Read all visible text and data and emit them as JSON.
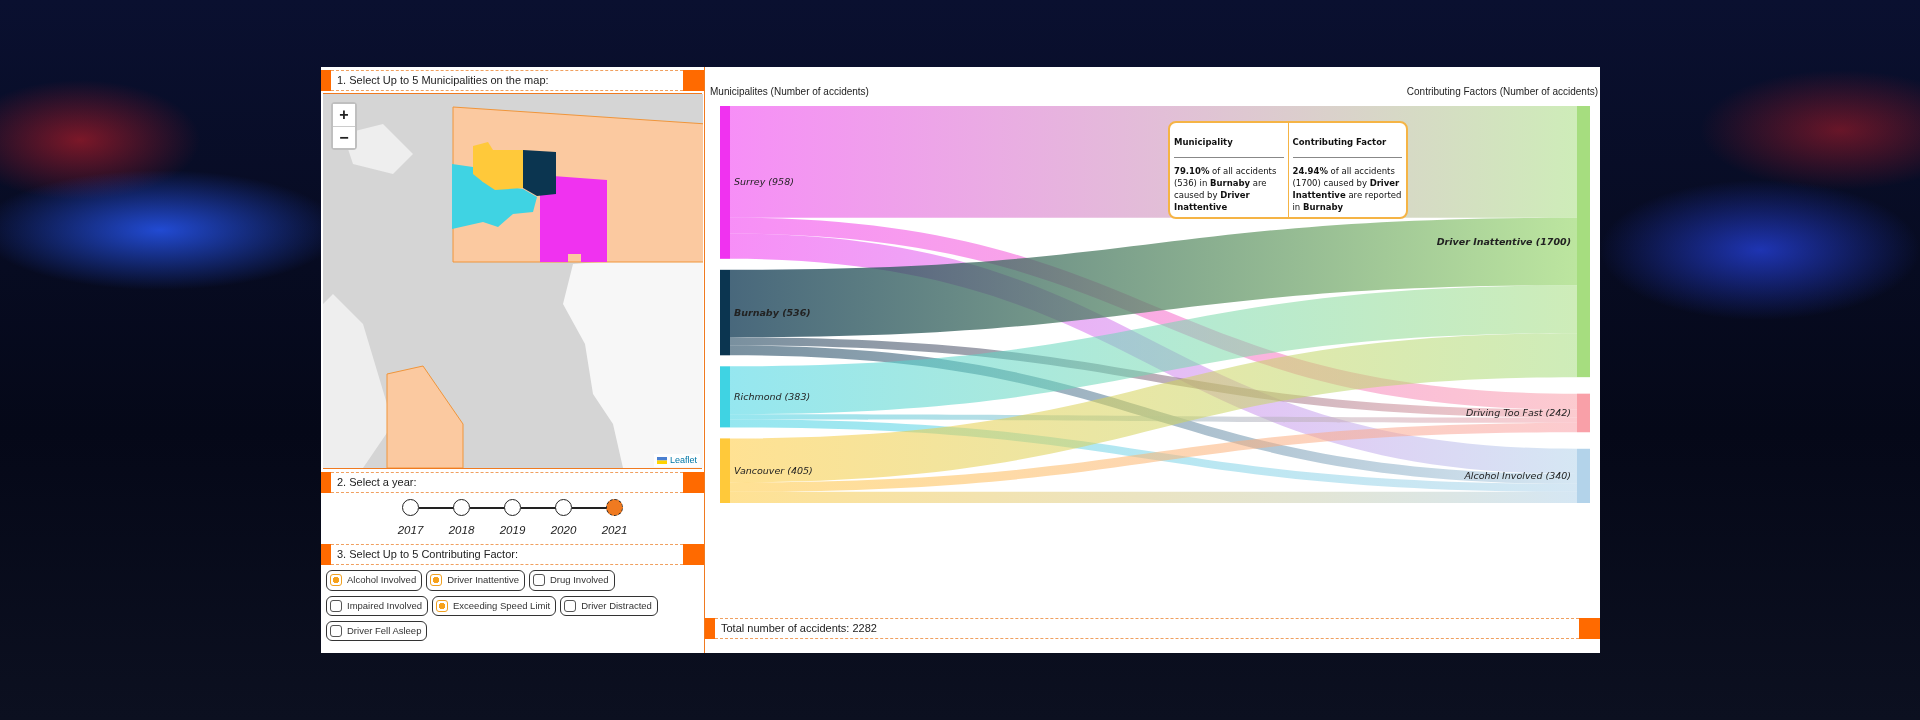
{
  "map_panel": {
    "heading": "1. Select Up to 5 Municipalities on the map:",
    "zoom_in": "+",
    "zoom_out": "−",
    "attribution": "Leaflet"
  },
  "year_panel": {
    "heading": "2. Select a year:",
    "years": [
      {
        "label": "2017",
        "selected": false
      },
      {
        "label": "2018",
        "selected": false
      },
      {
        "label": "2019",
        "selected": false
      },
      {
        "label": "2020",
        "selected": false
      },
      {
        "label": "2021",
        "selected": true
      }
    ]
  },
  "factor_panel": {
    "heading": "3. Select Up to 5 Contributing Factor:",
    "factors": [
      {
        "label": "Alcohol Involved",
        "checked": true
      },
      {
        "label": "Driver Inattentive",
        "checked": true
      },
      {
        "label": "Drug Involved",
        "checked": false
      },
      {
        "label": "Impaired Involved",
        "checked": false
      },
      {
        "label": "Exceeding Speed Limit",
        "checked": true
      },
      {
        "label": "Driver Distracted",
        "checked": false
      },
      {
        "label": "Driver Fell Asleep",
        "checked": false
      }
    ]
  },
  "chart": {
    "left_title": "Municipalites (Number of accidents)",
    "right_title": "Contributing Factors (Number of accidents)",
    "municipalities": [
      {
        "label": "Surrey (958)",
        "color": "#f032f0",
        "highlighted": false
      },
      {
        "label": "Burnaby (536)",
        "color": "#0b3550",
        "highlighted": true
      },
      {
        "label": "Richmond (383)",
        "color": "#3fd3e3",
        "highlighted": false
      },
      {
        "label": "Vancouver (405)",
        "color": "#ffc93a",
        "highlighted": false
      }
    ],
    "factors": [
      {
        "label": "Driver Inattentive (1700)",
        "color": "#a6dd7f",
        "highlighted": true
      },
      {
        "label": "Driving Too Fast (242)",
        "color": "#f9a0a8",
        "highlighted": false
      },
      {
        "label": "Alcohol Involved (340)",
        "color": "#b3d3ea",
        "highlighted": false
      }
    ],
    "tooltip": {
      "columns": [
        {
          "heading": "Municipality",
          "text": "**79.10%** of all accidents (536) in **Burnaby** are caused by **Driver Inattentive**"
        },
        {
          "heading": "Contributing Factor",
          "text": "**24.94%** of all accidents (1700) caused by **Driver Inattentive** are reported in **Burnaby**"
        }
      ]
    }
  },
  "footer": {
    "total": "Total number of accidents: 2282"
  }
}
